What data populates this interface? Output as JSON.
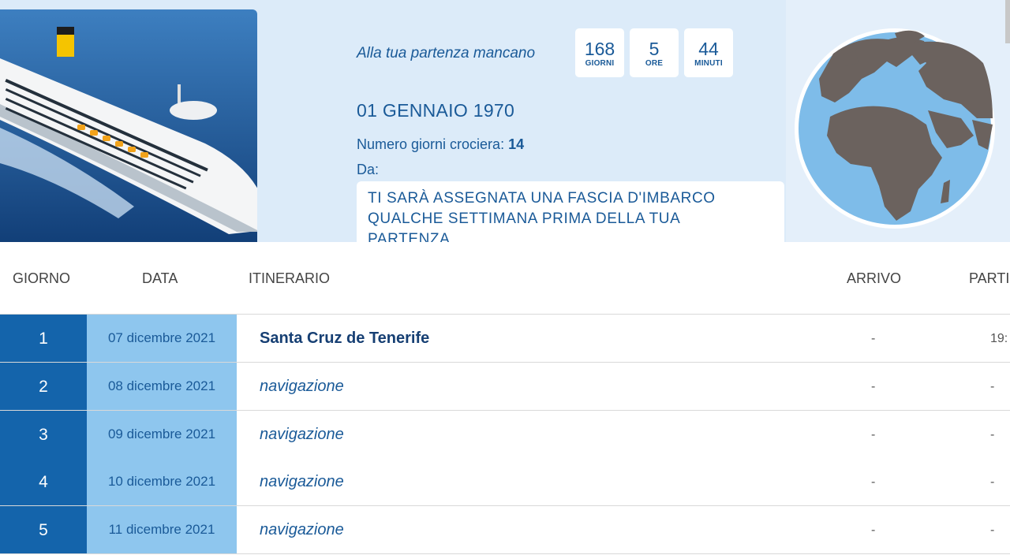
{
  "countdown": {
    "label": "Alla tua partenza mancano",
    "units": [
      {
        "value": "168",
        "unit": "GIORNI"
      },
      {
        "value": "5",
        "unit": "ORE"
      },
      {
        "value": "44",
        "unit": "MINUTI"
      }
    ]
  },
  "cruise": {
    "date": "01 GENNAIO 1970",
    "days_label": "Numero giorni crociera:",
    "days_value": "14",
    "from_label": "Da:",
    "boarding_line1": "TI SARÀ ASSEGNATA UNA FASCIA D'IMBARCO",
    "boarding_line2": "QUALCHE SETTIMANA PRIMA DELLA TUA",
    "boarding_line3": "PARTENZA"
  },
  "table": {
    "headers": {
      "day": "GIORNO",
      "date": "DATA",
      "itinerary": "ITINERARIO",
      "arrival": "ARRIVO",
      "departure": "PARTI"
    },
    "rows": [
      {
        "day": "1",
        "date": "07 dicembre 2021",
        "place": "Santa Cruz de Tenerife",
        "arrival": "-",
        "departure": "19:"
      },
      {
        "day": "2",
        "date": "08 dicembre 2021",
        "place": "navigazione",
        "arrival": "-",
        "departure": "-"
      },
      {
        "day": "3",
        "date": "09 dicembre 2021",
        "place": "navigazione",
        "arrival": "-",
        "departure": "-"
      },
      {
        "day": "4",
        "date": "10 dicembre 2021",
        "place": "navigazione",
        "arrival": "-",
        "departure": "-"
      },
      {
        "day": "5",
        "date": "11 dicembre 2021",
        "place": "navigazione",
        "arrival": "-",
        "departure": "-"
      }
    ]
  },
  "colors": {
    "hero_bg": "#dcebf9",
    "primary_blue": "#1464ab",
    "light_blue": "#8ec6ee",
    "text_blue": "#1a5a98"
  }
}
